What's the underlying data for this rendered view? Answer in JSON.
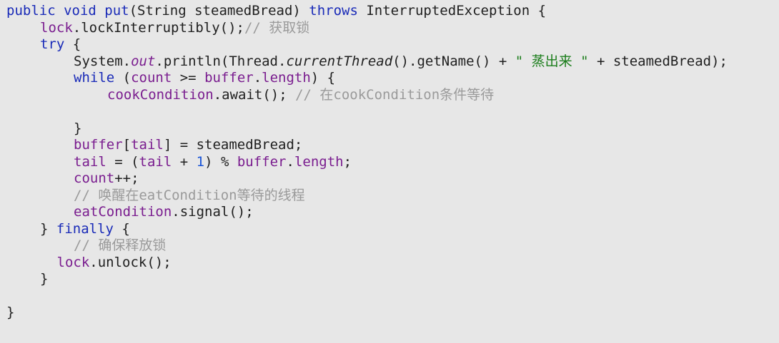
{
  "code": {
    "lines": [
      {
        "indent": 0,
        "tokens": [
          {
            "t": "public void ",
            "c": "kw"
          },
          {
            "t": "put",
            "c": "fn"
          },
          {
            "t": "(String steamedBread) ",
            "c": "plain"
          },
          {
            "t": "throws",
            "c": "kw"
          },
          {
            "t": " InterruptedException {",
            "c": "plain"
          }
        ]
      },
      {
        "indent": 1,
        "tokens": [
          {
            "t": "lock",
            "c": "field"
          },
          {
            "t": ".lockInterruptibly();",
            "c": "plain"
          },
          {
            "t": "// 获取锁",
            "c": "cmt"
          }
        ]
      },
      {
        "indent": 1,
        "tokens": [
          {
            "t": "try",
            "c": "kw"
          },
          {
            "t": " {",
            "c": "plain"
          }
        ]
      },
      {
        "indent": 2,
        "tokens": [
          {
            "t": "System.",
            "c": "plain"
          },
          {
            "t": "out",
            "c": "static"
          },
          {
            "t": ".println(Thread.",
            "c": "plain"
          },
          {
            "t": "currentThread",
            "c": "italic"
          },
          {
            "t": "().getName() + ",
            "c": "plain"
          },
          {
            "t": "\" 蒸出来 \"",
            "c": "str"
          },
          {
            "t": " + steamedBread);",
            "c": "plain"
          }
        ]
      },
      {
        "indent": 2,
        "tokens": [
          {
            "t": "while",
            "c": "kw"
          },
          {
            "t": " (",
            "c": "plain"
          },
          {
            "t": "count",
            "c": "field"
          },
          {
            "t": " >= ",
            "c": "plain"
          },
          {
            "t": "buffer",
            "c": "field"
          },
          {
            "t": ".",
            "c": "plain"
          },
          {
            "t": "length",
            "c": "field"
          },
          {
            "t": ") {",
            "c": "plain"
          }
        ]
      },
      {
        "indent": 3,
        "tokens": [
          {
            "t": "cookCondition",
            "c": "field"
          },
          {
            "t": ".await(); ",
            "c": "plain"
          },
          {
            "t": "// 在cookCondition条件等待",
            "c": "cmt"
          }
        ]
      },
      {
        "indent": 0,
        "tokens": []
      },
      {
        "indent": 2,
        "tokens": [
          {
            "t": "}",
            "c": "plain"
          }
        ]
      },
      {
        "indent": 2,
        "tokens": [
          {
            "t": "buffer",
            "c": "field"
          },
          {
            "t": "[",
            "c": "plain"
          },
          {
            "t": "tail",
            "c": "field"
          },
          {
            "t": "] = steamedBread;",
            "c": "plain"
          }
        ]
      },
      {
        "indent": 2,
        "tokens": [
          {
            "t": "tail",
            "c": "field"
          },
          {
            "t": " = (",
            "c": "plain"
          },
          {
            "t": "tail",
            "c": "field"
          },
          {
            "t": " + ",
            "c": "plain"
          },
          {
            "t": "1",
            "c": "num"
          },
          {
            "t": ") % ",
            "c": "plain"
          },
          {
            "t": "buffer",
            "c": "field"
          },
          {
            "t": ".",
            "c": "plain"
          },
          {
            "t": "length",
            "c": "field"
          },
          {
            "t": ";",
            "c": "plain"
          }
        ]
      },
      {
        "indent": 2,
        "tokens": [
          {
            "t": "count",
            "c": "field"
          },
          {
            "t": "++;",
            "c": "plain"
          }
        ]
      },
      {
        "indent": 2,
        "tokens": [
          {
            "t": "// 唤醒在eatCondition等待的线程",
            "c": "cmt"
          }
        ]
      },
      {
        "indent": 2,
        "tokens": [
          {
            "t": "eatCondition",
            "c": "field"
          },
          {
            "t": ".signal();",
            "c": "plain"
          }
        ]
      },
      {
        "indent": 1,
        "tokens": [
          {
            "t": "} ",
            "c": "plain"
          },
          {
            "t": "finally",
            "c": "kw"
          },
          {
            "t": " {",
            "c": "plain"
          }
        ]
      },
      {
        "indent": 2,
        "tokens": [
          {
            "t": "// 确保释放锁",
            "c": "cmt"
          }
        ]
      },
      {
        "indent": 1.5,
        "tokens": [
          {
            "t": "lock",
            "c": "field"
          },
          {
            "t": ".unlock();",
            "c": "plain"
          }
        ]
      },
      {
        "indent": 1,
        "tokens": [
          {
            "t": "}",
            "c": "plain"
          }
        ]
      },
      {
        "indent": 0,
        "tokens": []
      },
      {
        "indent": 0,
        "tokens": [
          {
            "t": "}",
            "c": "plain"
          }
        ]
      }
    ]
  }
}
